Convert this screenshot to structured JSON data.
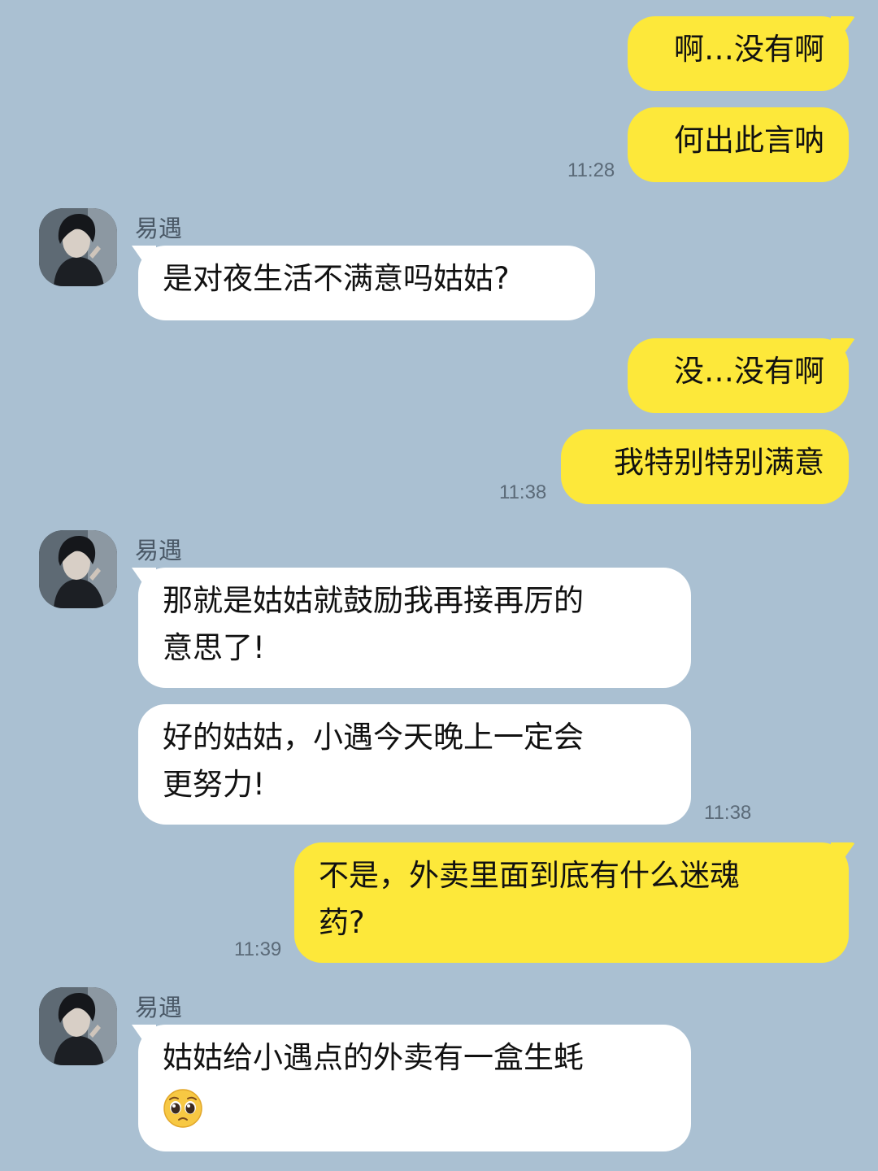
{
  "contact": {
    "name": "易遇",
    "avatar_icon": "portrait-avatar-icon"
  },
  "colors": {
    "background": "#aac0d2",
    "outgoing_bubble": "#fde83a",
    "incoming_bubble": "#ffffff"
  },
  "messages": [
    {
      "direction": "out",
      "text": "啊…没有啊"
    },
    {
      "direction": "out",
      "text": "何出此言呐",
      "time": "11:28"
    },
    {
      "direction": "in",
      "sender": "易遇",
      "text": "是对夜生活不满意吗姑姑?"
    },
    {
      "direction": "out",
      "text": "没…没有啊"
    },
    {
      "direction": "out",
      "text": "我特别特别满意",
      "time": "11:38"
    },
    {
      "direction": "in",
      "sender": "易遇",
      "lines": [
        "那就是姑姑就鼓励我再接再厉的",
        "意思了!"
      ]
    },
    {
      "direction": "in",
      "lines": [
        "好的姑姑，小遇今天晚上一定会",
        "更努力!"
      ],
      "time": "11:38"
    },
    {
      "direction": "out",
      "lines": [
        "不是，外卖里面到底有什么迷魂",
        "药?"
      ],
      "time": "11:39"
    },
    {
      "direction": "in",
      "sender": "易遇",
      "lines": [
        "姑姑给小遇点的外卖有一盒生蚝"
      ],
      "emoji": "pleading-face-emoji"
    }
  ]
}
